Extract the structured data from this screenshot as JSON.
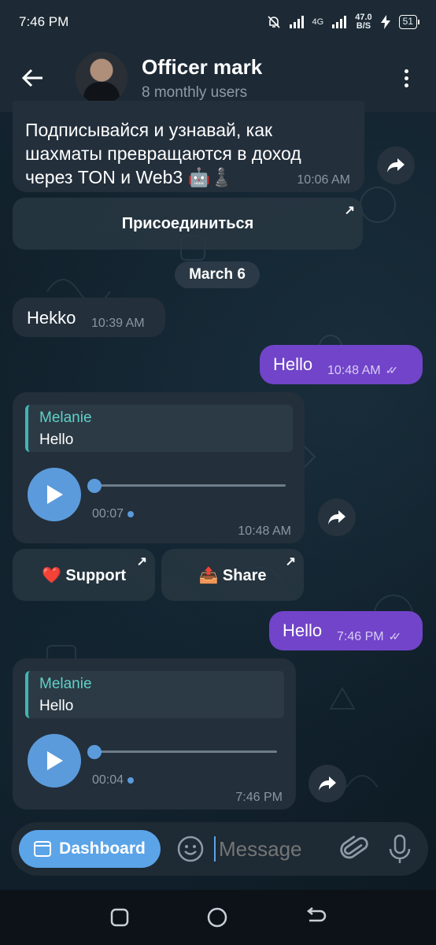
{
  "status_bar": {
    "time": "7:46 PM",
    "network": "4G",
    "speed": "47.0",
    "speed_unit": "B/S",
    "battery": "51"
  },
  "header": {
    "title": "Officer mark",
    "subtitle": "8 monthly users"
  },
  "messages": {
    "m1": {
      "text": "Подписывайся и узнавай, как шахматы превращаются в доход через TON и Web3 🤖♟️",
      "time": "10:06 AM",
      "button": "Присоединиться"
    },
    "date": "March 6",
    "m2": {
      "text": "Hekko",
      "time": "10:39 AM"
    },
    "m3": {
      "text": "Hello",
      "time": "10:48 AM"
    },
    "m4": {
      "quote_name": "Melanie",
      "quote_text": "Hello",
      "duration": "00:07",
      "time": "10:48 AM"
    },
    "buttons": {
      "support": "❤️ Support",
      "share": "📤 Share"
    },
    "m5": {
      "text": "Hello",
      "time": "7:46 PM"
    },
    "m6": {
      "quote_name": "Melanie",
      "quote_text": "Hello",
      "duration": "00:04",
      "time": "7:46 PM"
    }
  },
  "composer": {
    "dashboard_label": "Dashboard",
    "placeholder": "Message"
  },
  "colors": {
    "accent": "#5ba4e8",
    "outgoing": "#7144c9",
    "incoming": "#232f3b",
    "quote": "#5fd1c8"
  }
}
